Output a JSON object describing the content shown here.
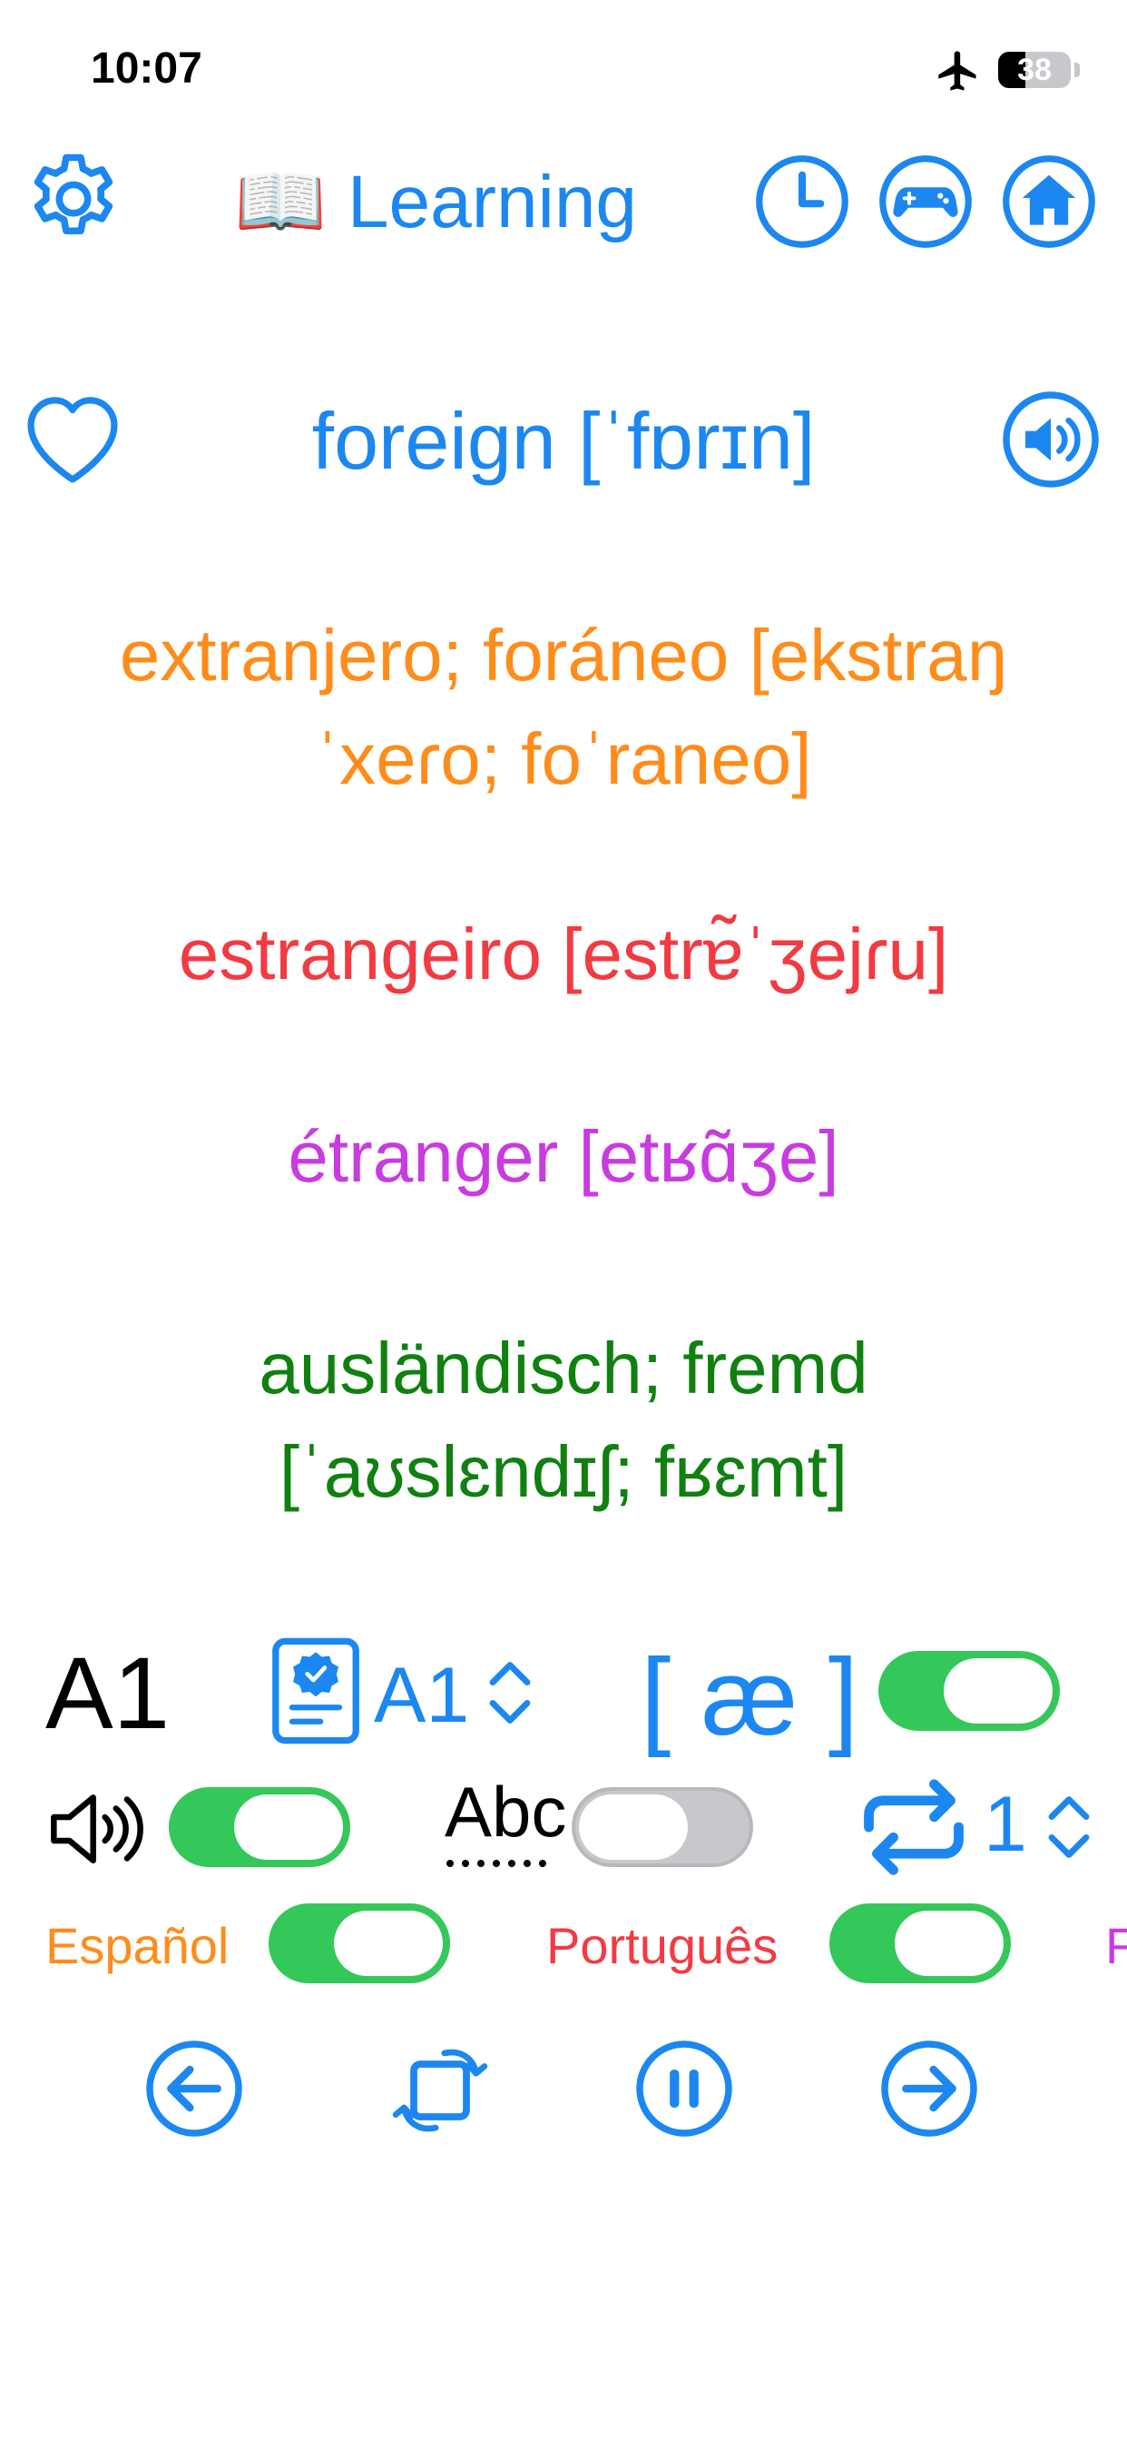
{
  "status_bar": {
    "time": "10:07",
    "battery": "38"
  },
  "header": {
    "title": "📖 Learning"
  },
  "word": {
    "english": "foreign [ˈfɒrɪn]",
    "spanish": "extranjero; foráneo [ekstraŋ ˈxeɾo; foˈraneo]",
    "portuguese": "estrangeiro [estrɐ̃ˈʒejɾu]",
    "french": "étranger [etʁɑ̃ʒe]",
    "german": "ausländisch; fremd [ˈaʊslɛndɪʃ; fʁɛmt]"
  },
  "controls": {
    "level_display": "A1",
    "level_selected": "A1",
    "ipa_symbol": "[ æ ]",
    "ipa_toggle": true,
    "sound_toggle": true,
    "spelling_label": "Abc",
    "spelling_toggle": false,
    "repeat_count": "1"
  },
  "languages": [
    {
      "label": "Español",
      "enabled": true,
      "color": "#FF8C1A"
    },
    {
      "label": "Português",
      "enabled": true,
      "color": "#F23A43"
    },
    {
      "label": "F",
      "enabled": true,
      "color": "#C83BE0"
    }
  ],
  "colors": {
    "accent": "#1C87F0",
    "toggle_on": "#34C759"
  }
}
